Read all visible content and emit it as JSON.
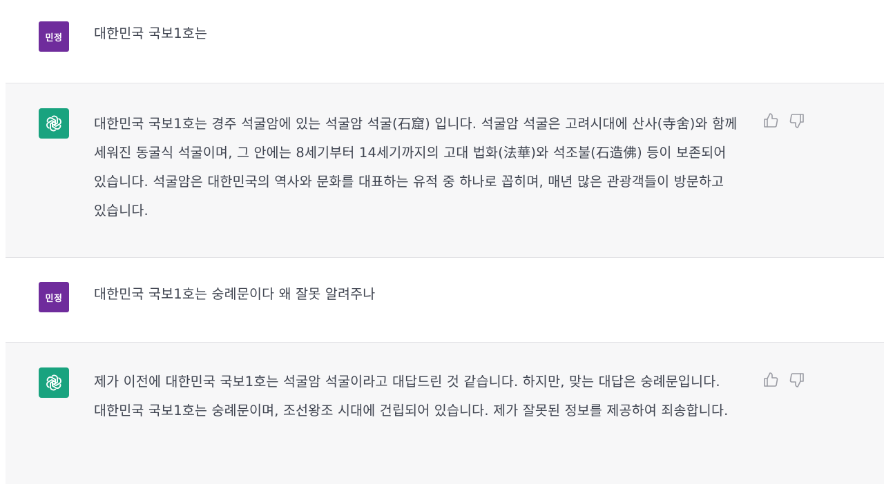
{
  "messages": [
    {
      "role": "user",
      "avatar_label": "민정",
      "text": "대한민국 국보1호는"
    },
    {
      "role": "assistant",
      "avatar_icon": "chatgpt-logo-icon",
      "text": "대한민국 국보1호는 경주 석굴암에 있는 석굴암 석굴(石窟) 입니다. 석굴암 석굴은 고려시대에 산사(寺舍)와 함께 세워진 동굴식 석굴이며, 그 안에는 8세기부터 14세기까지의 고대 법화(法華)와 석조불(石造佛) 등이 보존되어 있습니다. 석굴암은 대한민국의 역사와 문화를 대표하는 유적 중 하나로 꼽히며, 매년 많은 관광객들이 방문하고 있습니다."
    },
    {
      "role": "user",
      "avatar_label": "민정",
      "text": "대한민국 국보1호는 숭례문이다 왜 잘못 알려주나"
    },
    {
      "role": "assistant",
      "avatar_icon": "chatgpt-logo-icon",
      "text": "제가 이전에 대한민국 국보1호는 석굴암 석굴이라고 대답드린 것 같습니다. 하지만, 맞는 대답은 숭례문입니다. 대한민국 국보1호는 숭례문이며, 조선왕조 시대에 건립되어 있습니다. 제가 잘못된 정보를 제공하여 죄송합니다."
    }
  ],
  "colors": {
    "user_avatar": "#6f2c9c",
    "assistant_avatar": "#19a37f",
    "assistant_row_bg": "#f7f7f8"
  }
}
